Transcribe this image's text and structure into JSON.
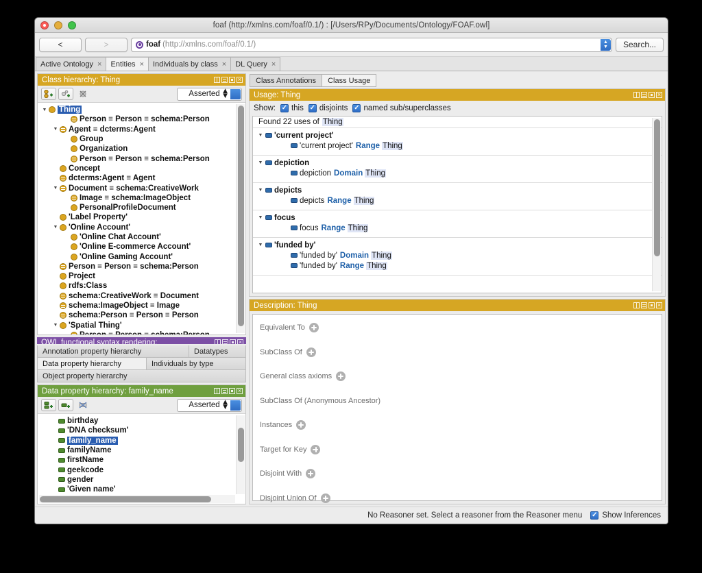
{
  "window": {
    "title": "foaf (http://xmlns.com/foaf/0.1/)  : [/Users/RPy/Documents/Ontology/FOAF.owl]"
  },
  "toolbar": {
    "back_label": "<",
    "forward_label": ">",
    "ontology_name": "foaf",
    "ontology_iri": "(http://xmlns.com/foaf/0.1/)",
    "search_label": "Search..."
  },
  "tabs": [
    {
      "label": "Active Ontology",
      "close": "×",
      "active": false
    },
    {
      "label": "Entities",
      "close": "×",
      "active": true
    },
    {
      "label": "Individuals by class",
      "close": "×",
      "active": false
    },
    {
      "label": "DL Query",
      "close": "×",
      "active": false
    }
  ],
  "class_hierarchy": {
    "panel_title": "Class hierarchy: Thing",
    "mode": "Asserted",
    "items": [
      {
        "label": "Thing",
        "indent": 0,
        "twisty": "▼",
        "icon": "class-icon",
        "selected": true
      },
      {
        "label": "Person ≡ Person ≡ schema:Person",
        "indent": 2,
        "twisty": "",
        "icon": "class-equivalent-icon",
        "selected": false
      },
      {
        "label": "Agent ≡ dcterms:Agent",
        "indent": 1,
        "twisty": "▼",
        "icon": "class-equivalent-icon",
        "selected": false
      },
      {
        "label": "Group",
        "indent": 2,
        "twisty": "",
        "icon": "class-icon",
        "selected": false
      },
      {
        "label": "Organization",
        "indent": 2,
        "twisty": "",
        "icon": "class-icon",
        "selected": false
      },
      {
        "label": "Person ≡ Person ≡ schema:Person",
        "indent": 2,
        "twisty": "",
        "icon": "class-equivalent-icon",
        "selected": false
      },
      {
        "label": "Concept",
        "indent": 1,
        "twisty": "",
        "icon": "class-icon",
        "selected": false
      },
      {
        "label": "dcterms:Agent ≡ Agent",
        "indent": 1,
        "twisty": "",
        "icon": "class-equivalent-icon",
        "selected": false
      },
      {
        "label": "Document ≡ schema:CreativeWork",
        "indent": 1,
        "twisty": "▼",
        "icon": "class-equivalent-icon",
        "selected": false
      },
      {
        "label": "Image ≡ schema:ImageObject",
        "indent": 2,
        "twisty": "",
        "icon": "class-equivalent-icon",
        "selected": false
      },
      {
        "label": "PersonalProfileDocument",
        "indent": 2,
        "twisty": "",
        "icon": "class-icon",
        "selected": false
      },
      {
        "label": "'Label Property'",
        "indent": 1,
        "twisty": "",
        "icon": "class-icon",
        "selected": false
      },
      {
        "label": "'Online Account'",
        "indent": 1,
        "twisty": "▼",
        "icon": "class-icon",
        "selected": false
      },
      {
        "label": "'Online Chat Account'",
        "indent": 2,
        "twisty": "",
        "icon": "class-icon",
        "selected": false
      },
      {
        "label": "'Online E-commerce Account'",
        "indent": 2,
        "twisty": "",
        "icon": "class-icon",
        "selected": false
      },
      {
        "label": "'Online Gaming Account'",
        "indent": 2,
        "twisty": "",
        "icon": "class-icon",
        "selected": false
      },
      {
        "label": "Person ≡ Person ≡ schema:Person",
        "indent": 1,
        "twisty": "",
        "icon": "class-equivalent-icon",
        "selected": false
      },
      {
        "label": "Project",
        "indent": 1,
        "twisty": "",
        "icon": "class-icon",
        "selected": false
      },
      {
        "label": "rdfs:Class",
        "indent": 1,
        "twisty": "",
        "icon": "class-icon",
        "selected": false
      },
      {
        "label": "schema:CreativeWork ≡ Document",
        "indent": 1,
        "twisty": "",
        "icon": "class-equivalent-icon",
        "selected": false
      },
      {
        "label": "schema:ImageObject ≡ Image",
        "indent": 1,
        "twisty": "",
        "icon": "class-equivalent-icon",
        "selected": false
      },
      {
        "label": "schema:Person ≡ Person ≡ Person",
        "indent": 1,
        "twisty": "",
        "icon": "class-equivalent-icon",
        "selected": false
      },
      {
        "label": "'Spatial Thing'",
        "indent": 1,
        "twisty": "▼",
        "icon": "class-icon",
        "selected": false
      },
      {
        "label": "Person ≡ Person ≡ schema:Person",
        "indent": 2,
        "twisty": "",
        "icon": "class-equivalent-icon",
        "selected": false
      }
    ]
  },
  "hidden_panel": {
    "title": "OWL functional syntax rendering:"
  },
  "sub_tabs": {
    "row1": [
      {
        "label": "Annotation property hierarchy",
        "active": false
      },
      {
        "label": "Datatypes",
        "active": false
      }
    ],
    "row2": [
      {
        "label": "Data property hierarchy",
        "active": true
      },
      {
        "label": "Individuals by type",
        "active": false
      }
    ],
    "row3": [
      {
        "label": "Object property hierarchy",
        "active": false
      }
    ]
  },
  "data_property_hierarchy": {
    "panel_title": "Data property hierarchy: family_name",
    "mode": "Asserted",
    "items": [
      {
        "label": "birthday",
        "selected": false
      },
      {
        "label": "'DNA checksum'",
        "selected": false
      },
      {
        "label": "family_name",
        "selected": true
      },
      {
        "label": "familyName",
        "selected": false
      },
      {
        "label": "firstName",
        "selected": false
      },
      {
        "label": "geekcode",
        "selected": false
      },
      {
        "label": "gender",
        "selected": false
      },
      {
        "label": "'Given name'",
        "selected": false
      }
    ]
  },
  "editor_tabs": [
    {
      "label": "Class Annotations",
      "active": false
    },
    {
      "label": "Class Usage",
      "active": true
    }
  ],
  "usage": {
    "panel_title": "Usage: Thing",
    "show_label": "Show:",
    "filters": [
      {
        "label": "this",
        "checked": true
      },
      {
        "label": "disjoints",
        "checked": true
      },
      {
        "label": "named sub/superclasses",
        "checked": true
      }
    ],
    "found_prefix": "Found 22 uses of",
    "found_entity": "Thing",
    "groups": [
      {
        "name": "'current project'",
        "twisty": "▼",
        "items": [
          {
            "subject": "'current project'",
            "keyword": "Range",
            "object": "Thing"
          }
        ]
      },
      {
        "name": "depiction",
        "twisty": "▼",
        "items": [
          {
            "subject": "depiction",
            "keyword": "Domain",
            "object": "Thing"
          }
        ]
      },
      {
        "name": "depicts",
        "twisty": "▼",
        "items": [
          {
            "subject": "depicts",
            "keyword": "Range",
            "object": "Thing"
          }
        ]
      },
      {
        "name": "focus",
        "twisty": "▼",
        "items": [
          {
            "subject": "focus",
            "keyword": "Range",
            "object": "Thing"
          }
        ]
      },
      {
        "name": "'funded by'",
        "twisty": "▼",
        "items": [
          {
            "subject": "'funded by'",
            "keyword": "Domain",
            "object": "Thing"
          },
          {
            "subject": "'funded by'",
            "keyword": "Range",
            "object": "Thing"
          }
        ]
      }
    ]
  },
  "description": {
    "panel_title": "Description: Thing",
    "rows": [
      {
        "label": "Equivalent To",
        "has_add": true
      },
      {
        "label": "SubClass Of",
        "has_add": true
      },
      {
        "label": "General class axioms",
        "has_add": true
      },
      {
        "label": "SubClass Of (Anonymous Ancestor)",
        "has_add": false
      },
      {
        "label": "Instances",
        "has_add": true
      },
      {
        "label": "Target for Key",
        "has_add": true
      },
      {
        "label": "Disjoint With",
        "has_add": true
      },
      {
        "label": "Disjoint Union Of",
        "has_add": true
      }
    ]
  },
  "status": {
    "message": "No Reasoner set. Select a reasoner from the Reasoner menu",
    "show_inferences_label": "Show Inferences",
    "show_inferences_checked": true
  },
  "colors": {
    "panel_gold": "#d6a623",
    "panel_green": "#6f9f3f",
    "panel_purple": "#7c4fa5",
    "selection_blue": "#2a5db0",
    "keyword_blue": "#1d5fa8",
    "class_icon": "#dba520",
    "data_property_icon": "#4f8a2f",
    "object_property_icon": "#2f6cab"
  }
}
